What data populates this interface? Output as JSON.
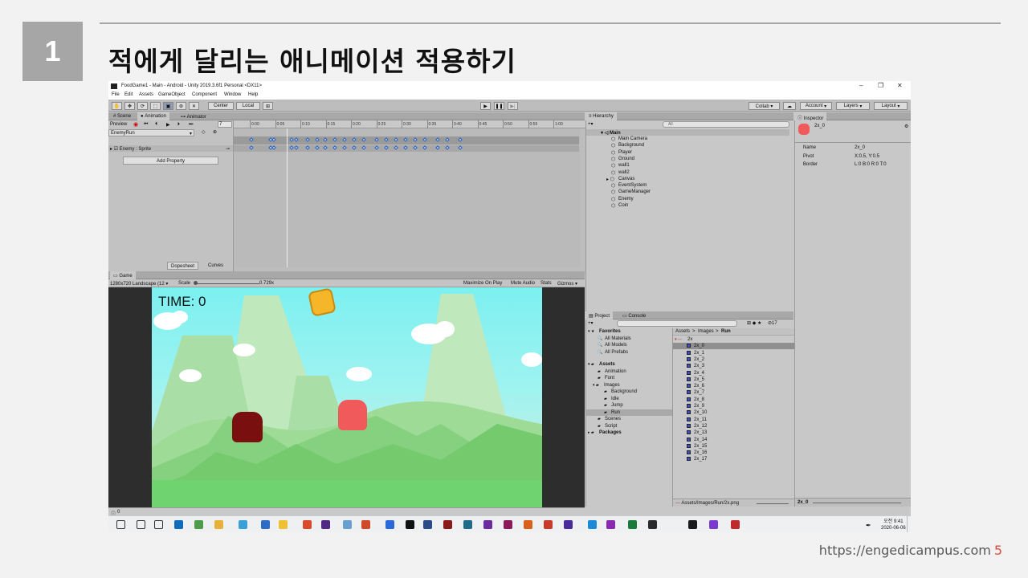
{
  "slide": {
    "number": "1",
    "title": "적에게 달리는 애니메이션 적용하기",
    "footer_url": "https://engedicampus.com",
    "page_number": "5"
  },
  "window": {
    "title": "FoodGame1 - Main - Android - Unity 2019.3.6f1 Personal <DX11>",
    "controls": [
      "–",
      "❐",
      "✕"
    ],
    "menu": [
      "File",
      "Edit",
      "Assets",
      "GameObject",
      "Component",
      "Window",
      "Help"
    ]
  },
  "toolbar": {
    "center": "Center",
    "local": "Local",
    "collab": "Collab ▾",
    "account": "Account",
    "layers": "Layers",
    "layout": "Layout"
  },
  "animation": {
    "tabs": [
      "Scene",
      "Animation",
      "Animator"
    ],
    "preview": "Preview",
    "frame": "7",
    "clip": "EnemyRun",
    "property": "Enemy : Sprite",
    "add_property": "Add Property",
    "dopesheet": "Dopesheet",
    "curves": "Curves",
    "ruler": [
      "0:00",
      "0:05",
      "0:10",
      "0:15",
      "0:20",
      "0:25",
      "0:30",
      "0:35",
      "0:40",
      "0:45",
      "0:50",
      "0:55",
      "1:00"
    ]
  },
  "game": {
    "tab": "Game",
    "resolution": "1280x720 Landscape (12 ▾",
    "scale_label": "Scale",
    "scale_value": "0.729x",
    "options": [
      "Maximize On Play",
      "Mute Audio",
      "Stats",
      "Gizmos ▾"
    ],
    "time_text": "TIME: 0"
  },
  "hierarchy": {
    "tab": "Hierarchy",
    "search": "All",
    "scene": "Main",
    "items": [
      "Main Camera",
      "Background",
      "Player",
      "Ground",
      "wall1",
      "wall2",
      "Canvas",
      "EventSystem",
      "GameManager",
      "Enemy",
      "Coin"
    ]
  },
  "inspector": {
    "tab": "Inspector",
    "object": "2x_0",
    "fields": [
      {
        "label": "Name",
        "value": "2x_0"
      },
      {
        "label": "Pivot",
        "value": "X:0.5, Y:0.5"
      },
      {
        "label": "Border",
        "value": "L:0 B:0 R:0 T:0"
      }
    ],
    "preview_label": "2x_0"
  },
  "project": {
    "tabs": [
      "Project",
      "Console"
    ],
    "count": "17",
    "favorites": "Favorites",
    "fav_items": [
      "All Materials",
      "All Models",
      "All Prefabs"
    ],
    "assets": "Assets",
    "folders": [
      "Animation",
      "Font",
      "Images",
      "Background",
      "Idle",
      "Jump",
      "Run",
      "Scenes",
      "Script"
    ],
    "packages": "Packages",
    "breadcrumb": [
      "Assets",
      "Images",
      "Run"
    ],
    "sprite_sheet": "2x",
    "files": [
      "2x_0",
      "2x_1",
      "2x_2",
      "2x_3",
      "2x_4",
      "2x_5",
      "2x_6",
      "2x_7",
      "2x_8",
      "2x_9",
      "2x_10",
      "2x_11",
      "2x_12",
      "2x_13",
      "2x_14",
      "2x_15",
      "2x_16",
      "2x_17"
    ],
    "path": "Assets/Images/Run/2x.png"
  },
  "status": {
    "text": "0"
  },
  "taskbar": {
    "time": "오전 9:41",
    "date": "2020-06-06"
  },
  "colors": {
    "badge": "#a6a6a6",
    "footer_page": "#e04c3c",
    "sky": "#7cf0f0",
    "ground": "#6fd36f",
    "enemy_dark": "#7a0f0f",
    "enemy_red": "#f05a5a",
    "selection": "#8f8f8f"
  }
}
